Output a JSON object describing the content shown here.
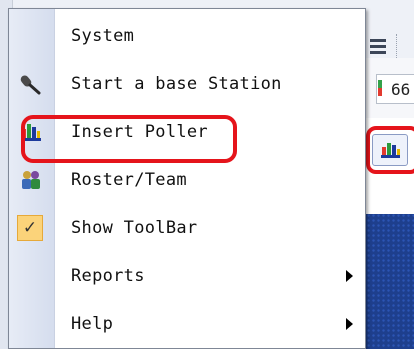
{
  "menu": {
    "items": [
      {
        "label": "System",
        "icon": "none",
        "has_submenu": false
      },
      {
        "label": "Start a base Station",
        "icon": "microphone-icon",
        "has_submenu": false
      },
      {
        "label": "Insert Poller",
        "icon": "bar-chart-icon",
        "has_submenu": false,
        "highlighted": true
      },
      {
        "label": "Roster/Team",
        "icon": "team-icon",
        "has_submenu": false
      },
      {
        "label": "Show ToolBar",
        "icon": "checkmark-icon",
        "has_submenu": false,
        "checked": true
      },
      {
        "label": "Reports",
        "icon": "none",
        "has_submenu": true
      },
      {
        "label": "Help",
        "icon": "none",
        "has_submenu": true
      }
    ]
  },
  "background": {
    "field_value": "66",
    "toolbar_icon": "list-icon",
    "poll_button_icon": "bar-chart-icon"
  },
  "colors": {
    "highlight": "#e5141b",
    "menu_gutter": "#dbe2f0",
    "checkbox_bg": "#fbd37a",
    "panel_bg": "#1e3f8d"
  }
}
